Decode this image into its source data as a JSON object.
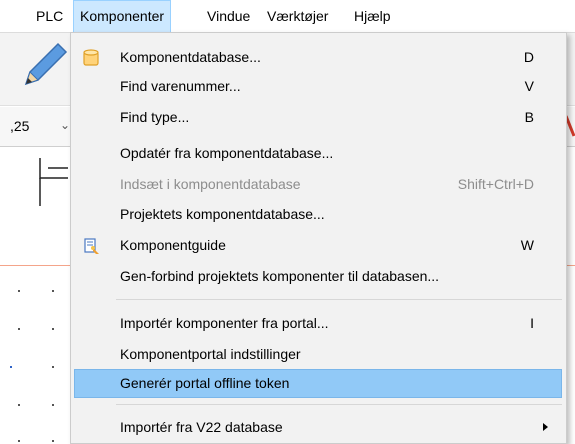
{
  "menubar": {
    "items": [
      {
        "label": "PLC"
      },
      {
        "label": "Komponenter"
      },
      {
        "label": "Vindue"
      },
      {
        "label": "Værktøjer"
      },
      {
        "label": "Hjælp"
      }
    ]
  },
  "toolbar": {
    "zoom_value": ",25",
    "zoom_chevron": "⌄"
  },
  "menu": {
    "items": [
      {
        "label": "Komponentdatabase...",
        "shortcut": "D"
      },
      {
        "label": "Find varenummer...",
        "shortcut": "V"
      },
      {
        "label": "Find type...",
        "shortcut": "B"
      },
      {
        "label": "Opdatér fra komponentdatabase...",
        "shortcut": ""
      },
      {
        "label": "Indsæt i komponentdatabase",
        "shortcut": "Shift+Ctrl+D",
        "disabled": true
      },
      {
        "label": "Projektets komponentdatabase...",
        "shortcut": ""
      },
      {
        "label": "Komponentguide",
        "shortcut": "W"
      },
      {
        "label": "Gen-forbind projektets komponenter til databasen...",
        "shortcut": ""
      },
      {
        "label": "Importér komponenter fra portal...",
        "shortcut": "I"
      },
      {
        "label": "Komponentportal indstillinger",
        "shortcut": ""
      },
      {
        "label": "Generér portal offline token",
        "shortcut": "",
        "highlighted": true
      },
      {
        "label": "Importér fra V22 database",
        "shortcut": "",
        "submenu": true
      }
    ]
  },
  "icons": {
    "database": "database-icon",
    "wizard": "component-guide-icon",
    "pencil": "pencil-icon"
  },
  "colors": {
    "highlight": "#91c9f7",
    "menubar_open": "#cce8ff",
    "menu_background": "#f2f2f2",
    "disabled_text": "#8d8d8d"
  }
}
